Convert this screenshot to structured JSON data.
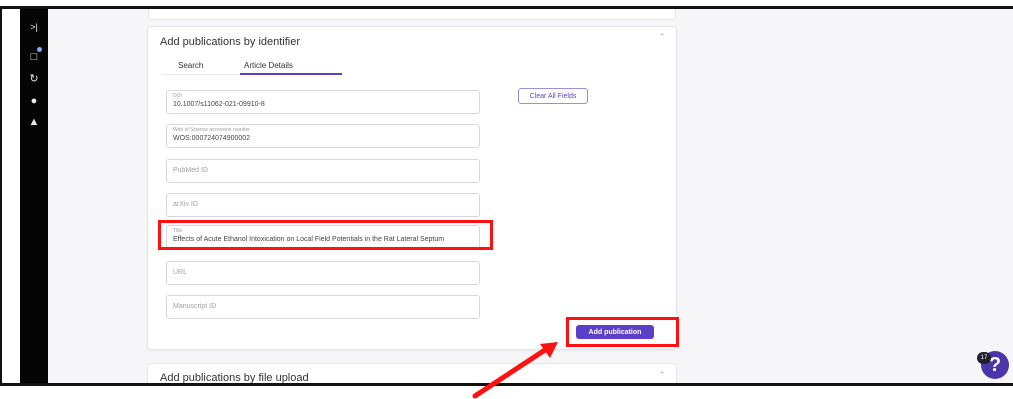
{
  "sidebar": {
    "icons": [
      "expand-icon",
      "folder-icon",
      "history-icon",
      "user-icon",
      "bell-icon"
    ]
  },
  "card": {
    "title": "Add publications by identifier",
    "tabs": [
      {
        "label": "Search",
        "active": false
      },
      {
        "label": "Article Details",
        "active": true
      }
    ],
    "fields": [
      {
        "label": "DOI",
        "value": "10.1007/s11062-021-09910-8",
        "placeholder": ""
      },
      {
        "label": "Web of Science accession number",
        "value": "WOS:000724074900002",
        "placeholder": ""
      },
      {
        "label": "",
        "value": "",
        "placeholder": "PubMed ID"
      },
      {
        "label": "",
        "value": "",
        "placeholder": "arXiv ID"
      },
      {
        "label": "Title",
        "value": "Effects of Acute Ethanol Intoxication on Local Field Potentials in the Rat Lateral Septum",
        "placeholder": ""
      },
      {
        "label": "",
        "value": "",
        "placeholder": "URL"
      },
      {
        "label": "",
        "value": "",
        "placeholder": "Manuscript ID"
      }
    ],
    "clear_label": "Clear All Fields",
    "add_label": "Add publication"
  },
  "card2": {
    "title": "Add publications by file upload"
  },
  "help": {
    "count": "17",
    "symbol": "?"
  },
  "colors": {
    "accent": "#5b3fc9",
    "highlight": "#ff1111",
    "sidebar": "#050505"
  }
}
